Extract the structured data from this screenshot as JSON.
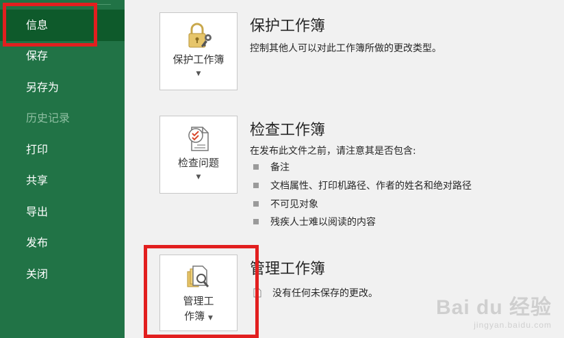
{
  "sidebar": {
    "items": [
      {
        "label": "信息",
        "active": true
      },
      {
        "label": "保存"
      },
      {
        "label": "另存为"
      },
      {
        "label": "历史记录",
        "disabled": true
      },
      {
        "label": "打印"
      },
      {
        "label": "共享"
      },
      {
        "label": "导出"
      },
      {
        "label": "发布"
      },
      {
        "label": "关闭"
      }
    ]
  },
  "protect": {
    "button_label": "保护工作簿",
    "icon": "lock-key-icon",
    "title": "保护工作簿",
    "description": "控制其他人可以对此工作簿所做的更改类型。"
  },
  "inspect": {
    "button_label": "检查问题",
    "icon": "document-inspect-icon",
    "title": "检查工作簿",
    "description": "在发布此文件之前，请注意其是否包含:",
    "bullets": [
      "备注",
      "文档属性、打印机路径、作者的姓名和绝对路径",
      "不可见对象",
      "残疾人士难以阅读的内容"
    ]
  },
  "manage": {
    "button_label_line1": "管理工",
    "button_label_line2": "作簿",
    "icon": "manage-workbook-icon",
    "title": "管理工作簿",
    "status": "没有任何未保存的更改。"
  },
  "watermark": {
    "main": "Bai du 经验",
    "sub": "jingyan.baidu.com"
  },
  "colors": {
    "sidebar": "#217346",
    "sidebar_active": "#0e5a2b",
    "annotation_red": "#e21f1f"
  }
}
